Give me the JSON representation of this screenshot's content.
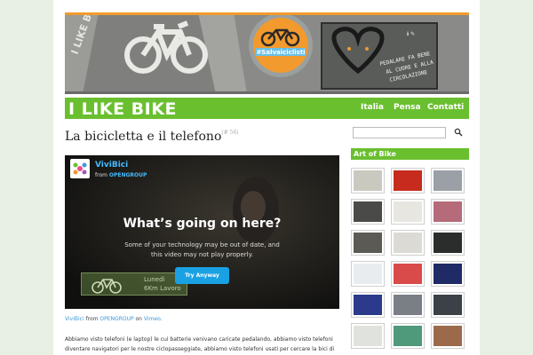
{
  "colors": {
    "accent_green": "#6abf2f",
    "accent_orange": "#f29a2e",
    "link_blue": "#3a9ad9",
    "vimeo_blue": "#1aa1e3",
    "page_bg": "#e8efe5"
  },
  "banner": {
    "sign_left": "I LIKE BIKE",
    "badge_text": "#Salvaiciclisti",
    "card_text_line1": "PEDALARE FA BENE",
    "card_text_line2": "AL CUORE E ALLA",
    "card_text_line3": "CIRCOLAZIONE"
  },
  "header": {
    "site_title": "I LIKE BIKE",
    "nav": [
      {
        "label": "Italia"
      },
      {
        "label": "Pensa"
      },
      {
        "label": "Contatti"
      }
    ]
  },
  "post": {
    "title": "La bicicletta e il telefono",
    "title_sup": "(# 56)",
    "video": {
      "channel_name": "ViviBici",
      "from_label": "from",
      "from_owner": "OPENGROUP",
      "heading": "What’s going on here?",
      "message": "Some of your technology may be out of date, and this video may not play properly.",
      "button_label": "Try Anyway",
      "sign_line1": "Lunedì",
      "sign_line2": "6Km Lavoro"
    },
    "caption": {
      "video_link": "ViviBici",
      "from": "from",
      "owner_link": "OPENGROUP",
      "on": "on",
      "site_link": "Vimeo",
      "end": "."
    },
    "body_text": "Abbiamo visto telefoni (e laptop) le cui batterie venivano caricate pedalando, abbiamo visto telefoni diventare navigatori per le nostre ciclopasseggiate, abbiamo visto telefoni usati per cercare la bici di"
  },
  "sidebar": {
    "search_icon": "search-icon",
    "heading": "Art of Bike",
    "thumbnails": [
      {
        "color": "#c9c9c0"
      },
      {
        "color": "#c62b1e"
      },
      {
        "color": "#9aa0a6"
      },
      {
        "color": "#4a4a48"
      },
      {
        "color": "#e8e6e0"
      },
      {
        "color": "#b56b7a"
      },
      {
        "color": "#5b5a55"
      },
      {
        "color": "#dcdad4"
      },
      {
        "color": "#2a2d2c"
      },
      {
        "color": "#e9ecef"
      },
      {
        "color": "#d94a4a"
      },
      {
        "color": "#1f2a66"
      },
      {
        "color": "#2b3a8a"
      },
      {
        "color": "#7a7f86"
      },
      {
        "color": "#3c4047"
      },
      {
        "color": "#e0e2de"
      },
      {
        "color": "#4f9a7a"
      },
      {
        "color": "#9b6a4a"
      }
    ]
  }
}
